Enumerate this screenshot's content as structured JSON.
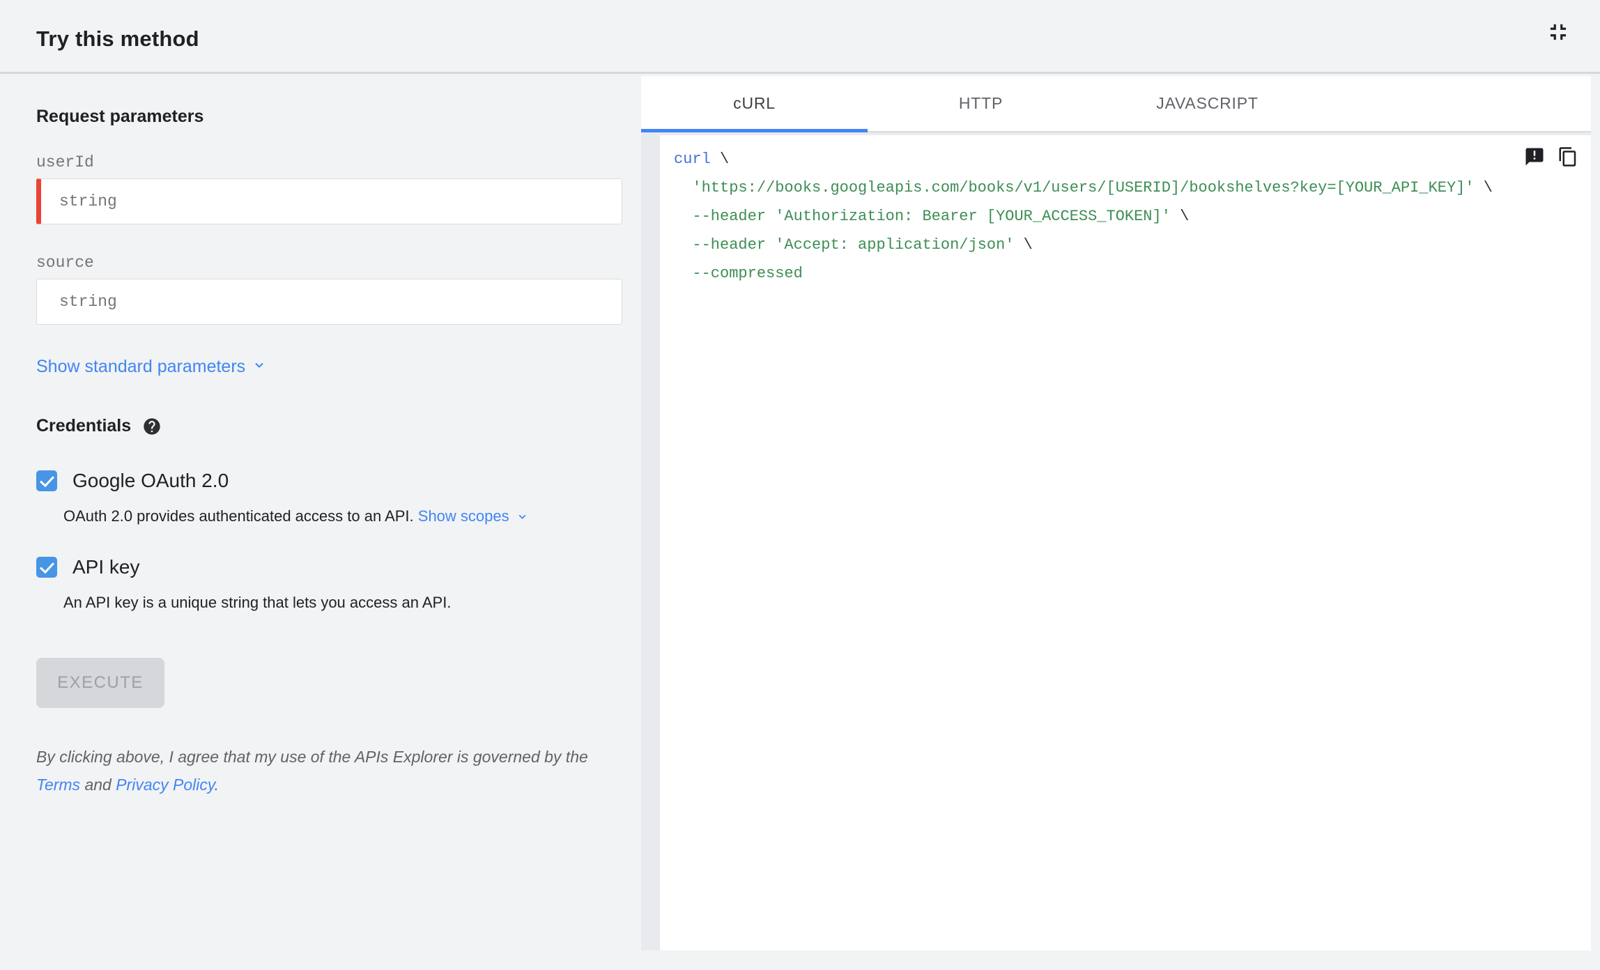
{
  "header": {
    "title": "Try this method"
  },
  "params": {
    "heading": "Request parameters",
    "fields": [
      {
        "label": "userId",
        "placeholder": "string",
        "required": true
      },
      {
        "label": "source",
        "placeholder": "string",
        "required": false
      }
    ],
    "show_standard_label": "Show standard parameters"
  },
  "credentials": {
    "heading": "Credentials",
    "oauth": {
      "label": "Google OAuth 2.0",
      "checked": true,
      "description": "OAuth 2.0 provides authenticated access to an API. ",
      "link_label": "Show scopes"
    },
    "apikey": {
      "label": "API key",
      "checked": true,
      "description": "An API key is a unique string that lets you access an API."
    }
  },
  "execute": {
    "label": "EXECUTE",
    "disabled": true
  },
  "disclaimer": {
    "text1": "By clicking above, I agree that my use of the APIs Explorer is governed by the ",
    "terms_label": "Terms",
    "text2": " and ",
    "privacy_label": "Privacy Policy",
    "text3": "."
  },
  "tabs": [
    {
      "label": "cURL",
      "active": true
    },
    {
      "label": "HTTP",
      "active": false
    },
    {
      "label": "JAVASCRIPT",
      "active": false
    }
  ],
  "code": {
    "language": "cURL",
    "lines": [
      [
        {
          "c": "kw",
          "t": "curl"
        },
        {
          "c": "pl",
          "t": " \\"
        }
      ],
      [
        {
          "c": "pl",
          "t": "  "
        },
        {
          "c": "str",
          "t": "'https://books.googleapis.com/books/v1/users/[USERID]/bookshelves?key=[YOUR_API_KEY]'"
        },
        {
          "c": "pl",
          "t": " \\"
        }
      ],
      [
        {
          "c": "pl",
          "t": "  "
        },
        {
          "c": "str",
          "t": "--header 'Authorization: Bearer [YOUR_ACCESS_TOKEN]'"
        },
        {
          "c": "pl",
          "t": " \\"
        }
      ],
      [
        {
          "c": "pl",
          "t": "  "
        },
        {
          "c": "str",
          "t": "--header 'Accept: application/json'"
        },
        {
          "c": "pl",
          "t": " \\"
        }
      ],
      [
        {
          "c": "pl",
          "t": "  "
        },
        {
          "c": "str",
          "t": "--compressed"
        }
      ]
    ]
  },
  "icons": {
    "collapse": "fullscreen-exit-icon",
    "help": "help-icon",
    "feedback": "feedback-icon",
    "copy": "copy-icon",
    "chevron": "chevron-down-icon"
  },
  "colors": {
    "accent_blue": "#4285f4",
    "checkbox_blue": "#4795e4",
    "required_red": "#ea4335",
    "code_keyword": "#4272db",
    "code_string": "#3d8e54",
    "panel_bg": "#f1f3f4",
    "gutter_bg": "#e8eaed",
    "disabled_btn_bg": "#d5d7da",
    "disabled_btn_text": "#9ba1a6"
  }
}
